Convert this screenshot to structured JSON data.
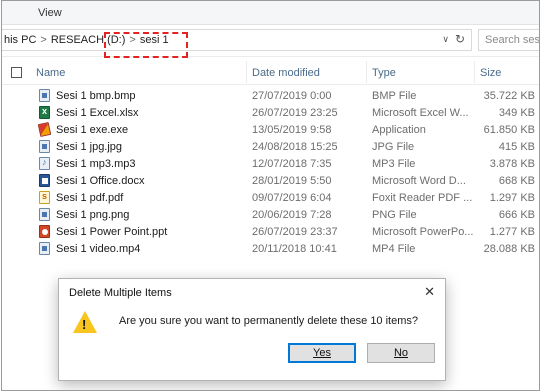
{
  "ribbon": {
    "tab_view": "View"
  },
  "address": {
    "crumbs": [
      "his PC",
      "RESEACH (D:)",
      "sesi 1"
    ],
    "separator": ">",
    "search_placeholder": "Search ses..."
  },
  "columns": {
    "name": "Name",
    "date": "Date modified",
    "type": "Type",
    "size": "Size"
  },
  "files": [
    {
      "name": "Sesi 1 bmp.bmp",
      "date": "27/07/2019 0:00",
      "type": "BMP File",
      "size": "35.722 KB",
      "icon": "image-file-icon"
    },
    {
      "name": "Sesi 1 Excel.xlsx",
      "date": "26/07/2019 23:25",
      "type": "Microsoft Excel W...",
      "size": "349 KB",
      "icon": "excel-file-icon"
    },
    {
      "name": "Sesi 1 exe.exe",
      "date": "13/05/2019 9:58",
      "type": "Application",
      "size": "61.850 KB",
      "icon": "application-icon"
    },
    {
      "name": "Sesi 1 jpg.jpg",
      "date": "24/08/2018 15:25",
      "type": "JPG File",
      "size": "415 KB",
      "icon": "image-file-icon"
    },
    {
      "name": "Sesi 1 mp3.mp3",
      "date": "12/07/2018 7:35",
      "type": "MP3 File",
      "size": "3.878 KB",
      "icon": "audio-file-icon"
    },
    {
      "name": "Sesi 1 Office.docx",
      "date": "28/01/2019 5:50",
      "type": "Microsoft Word D...",
      "size": "668 KB",
      "icon": "word-file-icon"
    },
    {
      "name": "Sesi 1 pdf.pdf",
      "date": "09/07/2019 6:04",
      "type": "Foxit Reader PDF ...",
      "size": "1.297 KB",
      "icon": "pdf-file-icon"
    },
    {
      "name": "Sesi 1 png.png",
      "date": "20/06/2019 7:28",
      "type": "PNG File",
      "size": "666 KB",
      "icon": "image-file-icon"
    },
    {
      "name": "Sesi 1 Power Point.ppt",
      "date": "26/07/2019 23:37",
      "type": "Microsoft PowerPo...",
      "size": "1.277 KB",
      "icon": "powerpoint-file-icon"
    },
    {
      "name": "Sesi 1 video.mp4",
      "date": "20/11/2018 10:41",
      "type": "MP4 File",
      "size": "28.088 KB",
      "icon": "video-file-icon"
    }
  ],
  "dialog": {
    "title": "Delete Multiple Items",
    "close": "✕",
    "message": "Are you sure you want to permanently delete these 10 items?",
    "yes_label": "Yes",
    "no_label": "No",
    "icon": "warning-icon"
  },
  "colors": {
    "highlight_border": "#e52222",
    "header_text": "#4a6b8a",
    "warning": "#f7c51e",
    "primary_button_border": "#0078d7"
  }
}
